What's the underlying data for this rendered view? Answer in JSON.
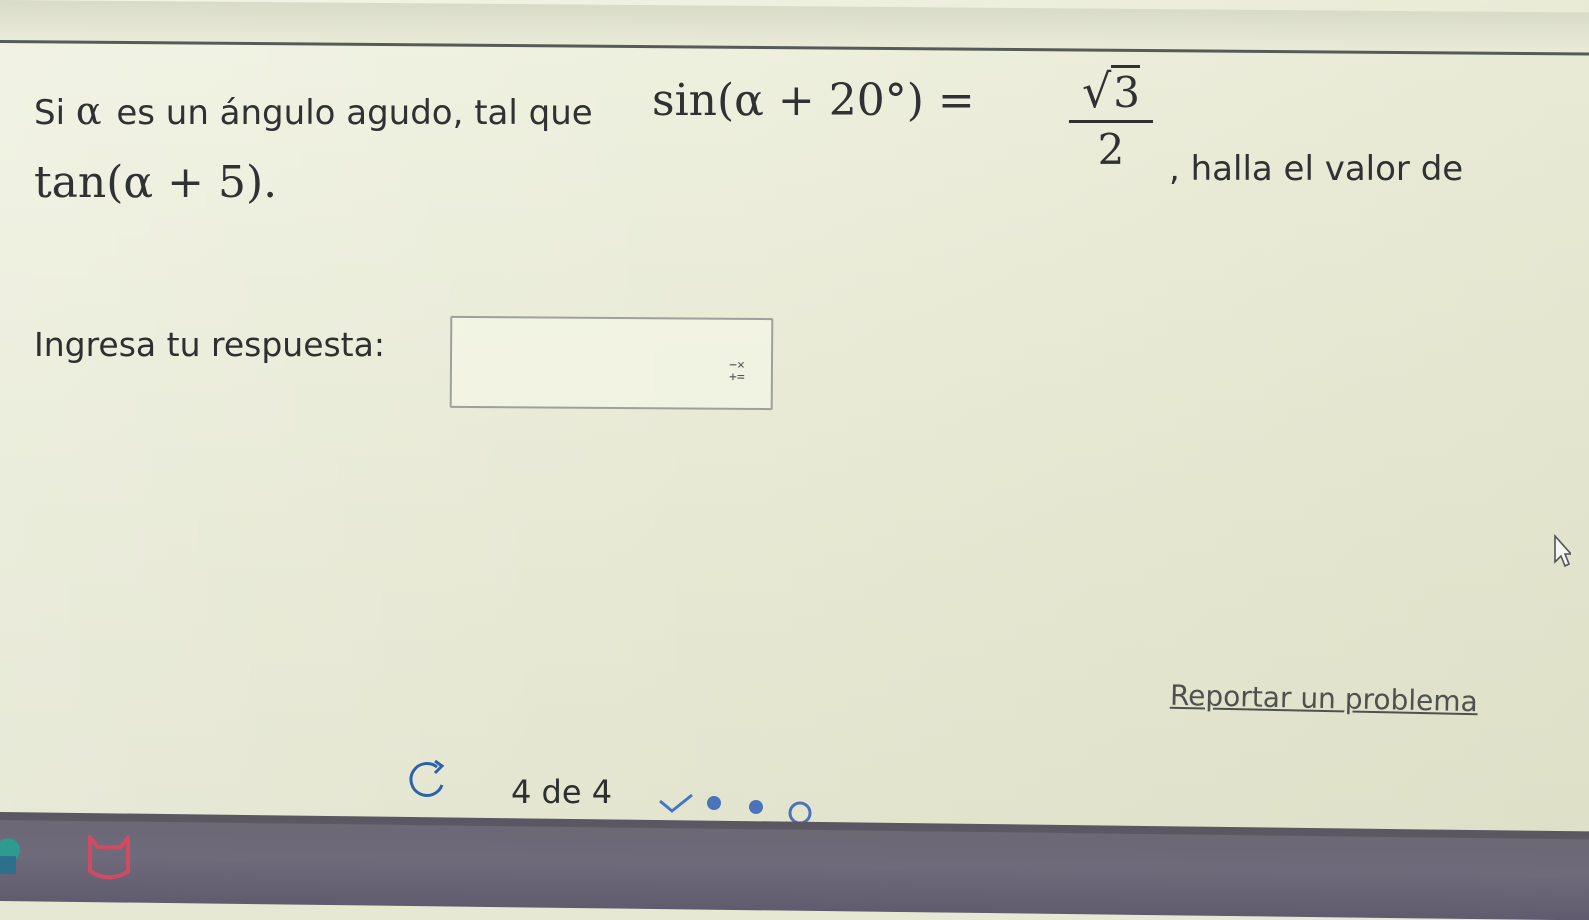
{
  "question": {
    "prefix_label": "Si ",
    "alpha_symbol": "α",
    "text": "es un ángulo agudo, tal que",
    "condition": "sin(α + 20°) =",
    "fraction_numerator_sqrt": "√",
    "fraction_numerator_radicand": "3",
    "fraction_denominator": "2",
    "suffix": ", halla el valor de",
    "target_expression": "tan(α + 5)."
  },
  "answer": {
    "label": "Ingresa tu respuesta:",
    "input_value": "",
    "input_placeholder": "",
    "keyboard_icon": "math-keyboard-icon",
    "keyboard_glyph": "−×\n+="
  },
  "report_link": "Reportar un problema",
  "progress": {
    "text": "4 de 4",
    "current": 4,
    "total": 4,
    "refresh_icon": "refresh-icon",
    "steps": [
      "completed-check",
      "filled-dot",
      "filled-dot",
      "current-empty-dot"
    ]
  },
  "colors": {
    "page_bg": "#e6e8d4",
    "text": "#2f3132",
    "taskbar": "#6b6774",
    "taskbar_accent": "#d14a62"
  }
}
